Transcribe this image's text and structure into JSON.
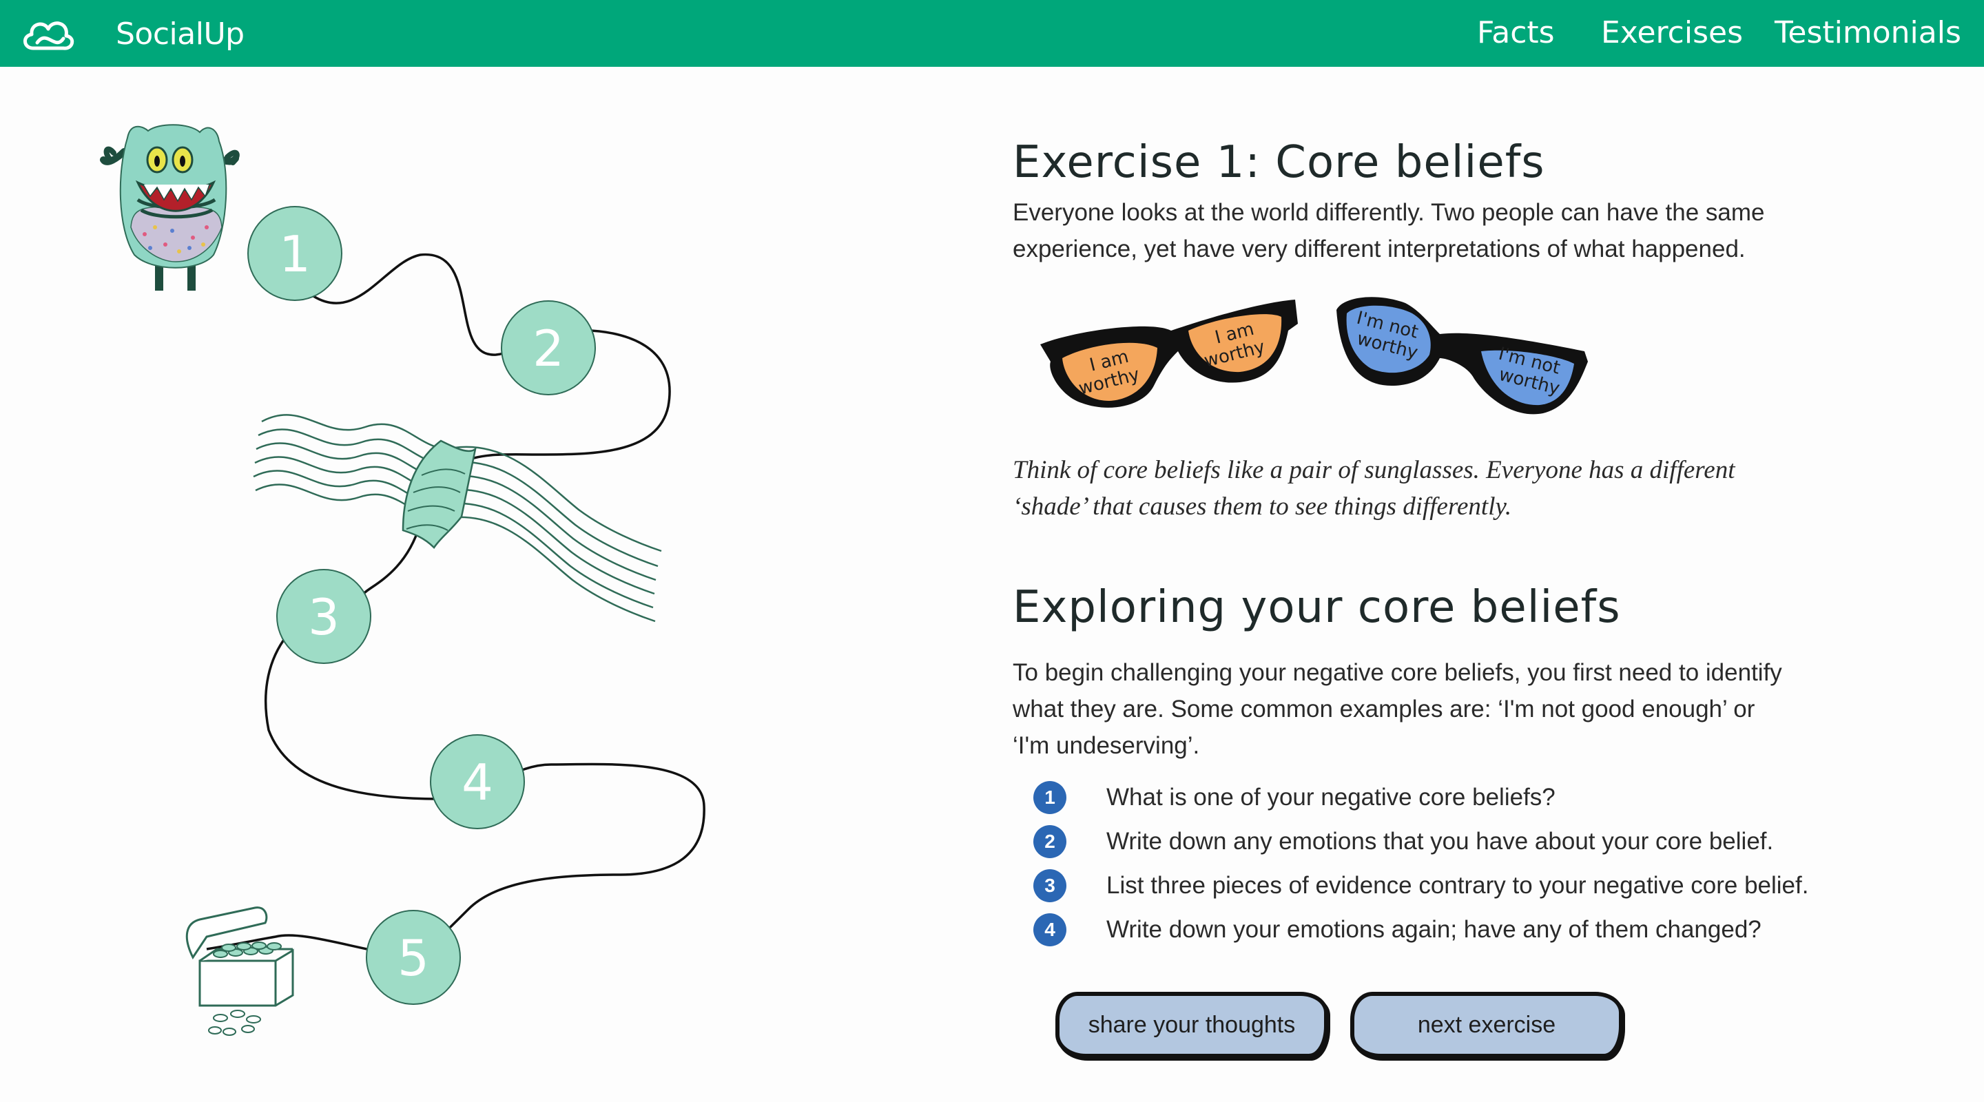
{
  "nav": {
    "brand": "SocialUp",
    "links": [
      "Facts",
      "Exercises",
      "Testimonials"
    ],
    "color": "#00a77a"
  },
  "path": {
    "steps": [
      "1",
      "2",
      "3",
      "4",
      "5"
    ],
    "circle_color": "#9edcc6"
  },
  "exercise": {
    "title": "Exercise 1: Core beliefs",
    "intro": "Everyone looks at the world differently. Two people can have the same experience, yet have very different interpretations of what happened.",
    "glasses": {
      "positive_label": [
        "I am",
        "worthy"
      ],
      "negative_label": [
        "I'm not",
        "worthy"
      ],
      "positive_color": "#f4a65c",
      "negative_color": "#6a9be0"
    },
    "caption": "Think of core beliefs like a pair of sunglasses. Everyone has a different ‘shade’ that causes them to see things differently."
  },
  "exploring": {
    "title": "Exploring your core beliefs",
    "text": "To begin challenging your negative core beliefs, you first need to identify what they are. Some common examples are: ‘I'm not good enough’ or ‘I'm undeserving’.",
    "steps": [
      {
        "num": "1",
        "text": "What is one of your negative core beliefs?"
      },
      {
        "num": "2",
        "text": "Write down any emotions that you have about your core belief."
      },
      {
        "num": "3",
        "text": "List three pieces of evidence contrary to your negative core belief."
      },
      {
        "num": "4",
        "text": "Write down your emotions again; have any of them changed?"
      }
    ],
    "badge_color": "#2b67b4"
  },
  "buttons": {
    "share": "share your thoughts",
    "next": "next exercise",
    "color": "#b3c7e0"
  }
}
